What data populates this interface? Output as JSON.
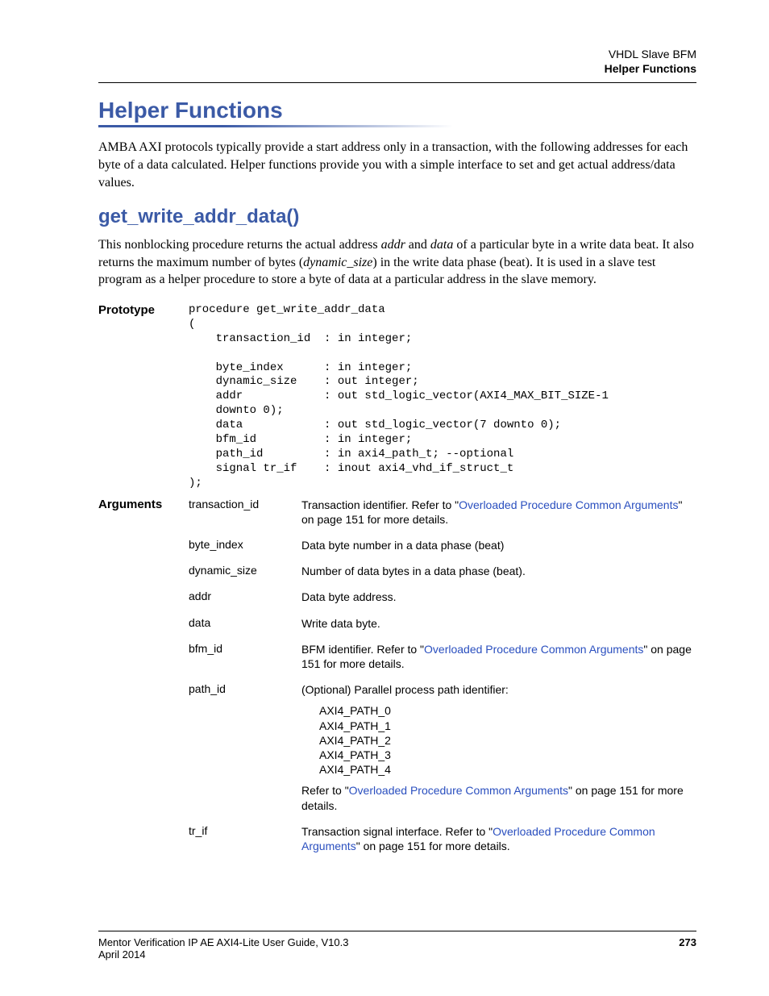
{
  "header": {
    "line1": "VHDL Slave BFM",
    "line2": "Helper Functions"
  },
  "section": {
    "title": "Helper Functions",
    "intro": "AMBA AXI protocols typically provide a start address only in a transaction, with the following addresses for each byte of a data  calculated. Helper functions provide you with a simple interface to set and get actual address/data values."
  },
  "subsection": {
    "title": "get_write_addr_data()",
    "para_pre": "This nonblocking procedure returns the actual address ",
    "para_addr": "addr",
    "para_mid1": " and ",
    "para_data": "data",
    "para_mid2": " of a particular byte in a write data beat. It also returns the maximum number of bytes (",
    "para_dyn": "dynamic_size",
    "para_end": ") in the write data phase (beat). It is used in a slave test program as a helper procedure to store a byte of data at a particular address in the slave memory."
  },
  "labels": {
    "prototype": "Prototype",
    "arguments": "Arguments"
  },
  "code": "procedure get_write_addr_data\n(\n    transaction_id  : in integer;\n\n    byte_index      : in integer;\n    dynamic_size    : out integer;\n    addr            : out std_logic_vector(AXI4_MAX_BIT_SIZE-1\n    downto 0);\n    data            : out std_logic_vector(7 downto 0);\n    bfm_id          : in integer;\n    path_id         : in axi4_path_t; --optional\n    signal tr_if    : inout axi4_vhd_if_struct_t\n);",
  "args": {
    "transaction_id": {
      "name": "transaction_id",
      "pre": "Transaction identifier. Refer to \"",
      "link": "Overloaded Procedure Common Arguments",
      "post": "\" on page 151 for more details."
    },
    "byte_index": {
      "name": "byte_index",
      "desc": "Data byte number in a data phase (beat)"
    },
    "dynamic_size": {
      "name": "dynamic_size",
      "desc": "Number of data bytes in a data phase (beat)."
    },
    "addr": {
      "name": "addr",
      "desc": "Data byte address."
    },
    "data": {
      "name": "data",
      "desc": "Write data byte."
    },
    "bfm_id": {
      "name": "bfm_id",
      "pre": "BFM identifier. Refer to \"",
      "link": "Overloaded Procedure Common Arguments",
      "post": "\" on page 151 for more details."
    },
    "path_id": {
      "name": "path_id",
      "desc": "(Optional) Parallel process path identifier:",
      "p0": "AXI4_PATH_0",
      "p1": "AXI4_PATH_1",
      "p2": "AXI4_PATH_2",
      "p3": "AXI4_PATH_3",
      "p4": "AXI4_PATH_4",
      "post_pre": "Refer to \"",
      "post_link": "Overloaded Procedure Common Arguments",
      "post_end": "\" on page 151 for more details."
    },
    "tr_if": {
      "name": "tr_if",
      "pre": "Transaction signal interface. Refer to \"",
      "link": "Overloaded Procedure Common Arguments",
      "post": "\" on page 151 for more details."
    }
  },
  "footer": {
    "guide": "Mentor Verification IP AE AXI4-Lite User Guide, V10.3",
    "date": "April 2014",
    "page": "273"
  }
}
